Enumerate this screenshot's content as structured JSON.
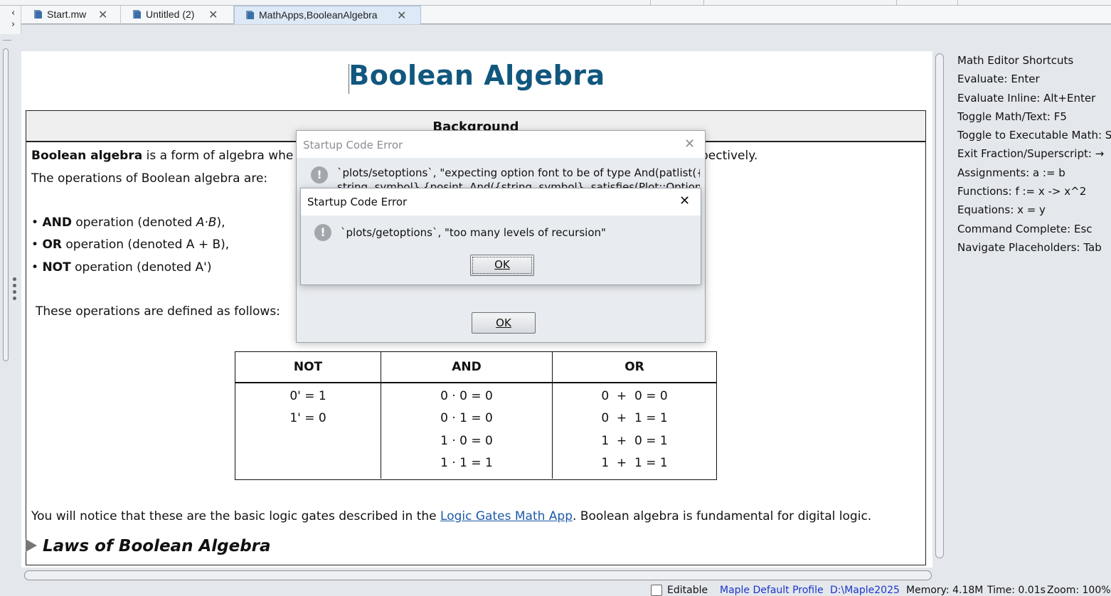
{
  "tabs": [
    {
      "label": "Start.mw",
      "active": false
    },
    {
      "label": "Untitled (2)",
      "active": false
    },
    {
      "label": "MathApps,BooleanAlgebra",
      "active": true
    }
  ],
  "tab_close_glyph": "✕",
  "nav_arrows": {
    "left": "‹",
    "right": "›"
  },
  "document": {
    "title": "Boolean Algebra",
    "section_header": "Background",
    "para1_bold": "Boolean algebra",
    "para1_text": " is a form of algebra whe",
    "para1_tail": "pectively.",
    "para2": "The operations of Boolean algebra are:",
    "ops": [
      {
        "bullet": "•",
        "bold": "AND",
        "text": " operation (denoted ",
        "expr": "A·B",
        "close": "),"
      },
      {
        "bullet": "•",
        "bold": "OR",
        "text": " operation (denoted ",
        "expr": "A + B",
        "close": "),"
      },
      {
        "bullet": "•",
        "bold": "NOT",
        "text": " operation (denoted ",
        "expr": "A'",
        "close": ")"
      }
    ],
    "defined_text": "These operations are defined as follows:",
    "table": {
      "headers": [
        "NOT",
        "AND",
        "OR"
      ],
      "not_rows": [
        "0' = 1",
        "1' = 0"
      ],
      "and_rows": [
        "0 · 0 = 0",
        "0 · 1 = 0",
        "1 · 0 = 0",
        "1 · 1 = 1"
      ],
      "or_rows": [
        "0  +  0 = 0",
        "0  +  1 = 1",
        "1  +  0 = 1",
        "1  +  1 = 1"
      ]
    },
    "notice_pre": "You will notice that these are the basic logic gates described in the ",
    "notice_link": "Logic Gates Math App",
    "notice_post": ". Boolean algebra is fundamental for digital logic.",
    "laws_heading": "Laws of Boolean Algebra"
  },
  "shortcuts": [
    "Math Editor Shortcuts",
    "Evaluate:  Enter",
    "Evaluate Inline:  Alt+Enter",
    "Toggle Math/Text:  F5",
    "Toggle to Executable Math:  Sh",
    "Exit Fraction/Superscript:  →",
    "Assignments:  a := b",
    "Functions:  f := x -> x^2",
    "Equations:  x = y",
    "Command Complete:  Esc",
    "Navigate Placeholders:  Tab"
  ],
  "dialog_back": {
    "title": "Startup Code Error",
    "message_line1": "`plots/setoptions`, \"expecting option font to be of type And(patlist({",
    "message_line2": "string, symbol},{posint, And({string, symbol}, satisfies(Plot::Options",
    "ok_label": "OK"
  },
  "dialog_front": {
    "title": "Startup Code Error",
    "message": "`plots/getoptions`, \"too many levels of recursion\"",
    "ok_label": "OK"
  },
  "dialog_close_glyph": "✕",
  "dialog_icon_glyph": "!",
  "status": {
    "editable_label": "Editable",
    "profile": "Maple Default Profile",
    "path": "D:\\Maple2025",
    "memory": "Memory: 4.18M",
    "time": "Time: 0.01s",
    "zoom": "Zoom: 100%"
  },
  "colors": {
    "title": "#11577e",
    "link": "#1d5aa8",
    "status_link": "#1a35c8"
  }
}
